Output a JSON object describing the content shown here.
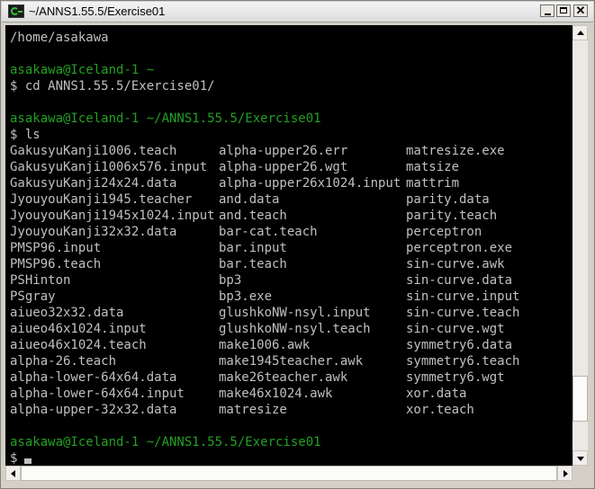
{
  "window": {
    "title": "~/ANNS1.55.5/Exercise01",
    "controls": {
      "minimize": "_",
      "maximize": "□",
      "close": "X"
    }
  },
  "theme": {
    "background": "#000000",
    "text": "#c0c0c0",
    "prompt": "#22a122"
  },
  "terminal": {
    "line_home": "/home/asakawa",
    "prompt1": "asakawa@Iceland-1 ~",
    "cmd_cd": "$ cd ANNS1.55.5/Exercise01/",
    "prompt2": "asakawa@Iceland-1 ~/ANNS1.55.5/Exercise01",
    "cmd_ls": "$ ls",
    "ls_rows": [
      [
        "GakusyuKanji1006.teach",
        "alpha-upper26.err",
        "matresize.exe"
      ],
      [
        "GakusyuKanji1006x576.input",
        "alpha-upper26.wgt",
        "matsize"
      ],
      [
        "GakusyuKanji24x24.data",
        "alpha-upper26x1024.input",
        "mattrim"
      ],
      [
        "JyouyouKanji1945.teacher",
        "and.data",
        "parity.data"
      ],
      [
        "JyouyouKanji1945x1024.input",
        "and.teach",
        "parity.teach"
      ],
      [
        "JyouyouKanji32x32.data",
        "bar-cat.teach",
        "perceptron"
      ],
      [
        "PMSP96.input",
        "bar.input",
        "perceptron.exe"
      ],
      [
        "PMSP96.teach",
        "bar.teach",
        "sin-curve.awk"
      ],
      [
        "PSHinton",
        "bp3",
        "sin-curve.data"
      ],
      [
        "PSgray",
        "bp3.exe",
        "sin-curve.input"
      ],
      [
        "aiueo32x32.data",
        "glushkoNW-nsyl.input",
        "sin-curve.teach"
      ],
      [
        "aiueo46x1024.input",
        "glushkoNW-nsyl.teach",
        "sin-curve.wgt"
      ],
      [
        "aiueo46x1024.teach",
        "make1006.awk",
        "symmetry6.data"
      ],
      [
        "alpha-26.teach",
        "make1945teacher.awk",
        "symmetry6.teach"
      ],
      [
        "alpha-lower-64x64.data",
        "make26teacher.awk",
        "symmetry6.wgt"
      ],
      [
        "alpha-lower-64x64.input",
        "make46x1024.awk",
        "xor.data"
      ],
      [
        "alpha-upper-32x32.data",
        "matresize",
        "xor.teach"
      ]
    ],
    "prompt3": "asakawa@Iceland-1 ~/ANNS1.55.5/Exercise01",
    "cmd_final": "$"
  },
  "scrollbar": {
    "vertical_position": 0.92
  }
}
